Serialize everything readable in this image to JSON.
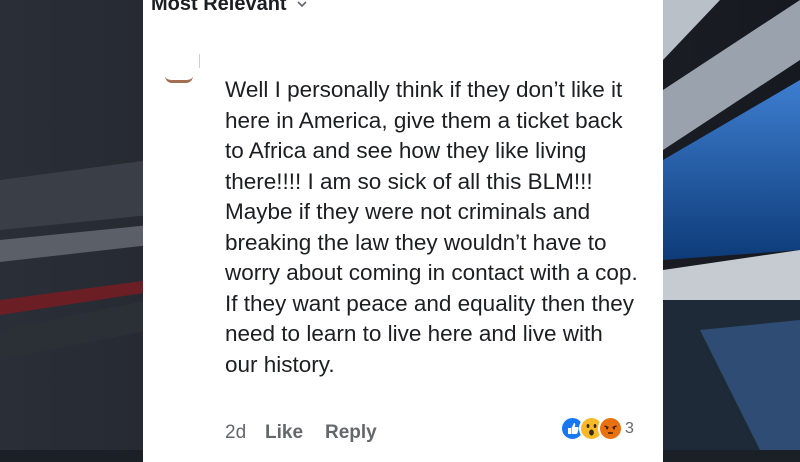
{
  "header": {
    "sort_label": "Most Relevant"
  },
  "comment": {
    "text": "Well I personally think if they don’t like it here in  America, give them a ticket back to Africa and see how they like living there!!!! I am so sick of all this BLM!!! Maybe if they were not criminals and breaking the law they wouldn’t have to worry about coming in contact with a cop. If they want peace and equality then they need to learn to live here and live with our history."
  },
  "actions": {
    "age": "2d",
    "like": "Like",
    "reply": "Reply"
  },
  "reactions": {
    "icons": [
      "like-icon",
      "wow-icon",
      "angry-icon"
    ],
    "count": "3"
  },
  "colors": {
    "text": "#1c1e21",
    "meta": "#65676b",
    "like_blue": "#1877f2",
    "wow_yellow": "#f7b928",
    "angry_orange": "#e9710f",
    "background_blue": "#1f5fa8"
  }
}
